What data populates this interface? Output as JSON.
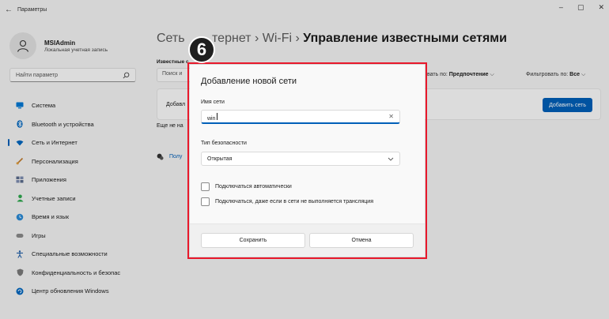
{
  "window": {
    "title": "Параметры",
    "back_glyph": "←",
    "minimize_glyph": "–",
    "maximize_glyph": "▢",
    "close_glyph": "✕"
  },
  "profile": {
    "name": "MSIAdmin",
    "account_type": "Локальная учетная запись"
  },
  "sidebar": {
    "search_placeholder": "Найти параметр",
    "items": [
      {
        "label": "Система",
        "icon": "monitor-icon",
        "color": "#0078d4"
      },
      {
        "label": "Bluetooth и устройства",
        "icon": "bluetooth-icon",
        "color": "#0067c0"
      },
      {
        "label": "Сеть и Интернет",
        "icon": "wifi-icon",
        "color": "#0067c0",
        "active": true
      },
      {
        "label": "Персонализация",
        "icon": "brush-icon",
        "color": "#c17a2c"
      },
      {
        "label": "Приложения",
        "icon": "apps-icon",
        "color": "#5b6b8c"
      },
      {
        "label": "Учетные записи",
        "icon": "person-icon",
        "color": "#2fa84f"
      },
      {
        "label": "Время и язык",
        "icon": "globe-clock-icon",
        "color": "#2c8bd6"
      },
      {
        "label": "Игры",
        "icon": "gamepad-icon",
        "color": "#8a8a8a"
      },
      {
        "label": "Специальные возможности",
        "icon": "accessibility-icon",
        "color": "#1f5fa8"
      },
      {
        "label": "Конфиденциальность и безопас",
        "icon": "shield-icon",
        "color": "#7a7a7a"
      },
      {
        "label": "Центр обновления Windows",
        "icon": "update-icon",
        "color": "#0067c0"
      }
    ]
  },
  "main": {
    "breadcrumb_part1": "Сеть ",
    "breadcrumb_part2": "тернет",
    "breadcrumb_sep1": " › ",
    "breadcrumb_part3": "Wi-Fi",
    "breadcrumb_sep2": " › ",
    "breadcrumb_current": "Управление известными сетями",
    "known_label": "Известные с",
    "search_placeholder": "Поиск и",
    "sort_prefix": "вать по: ",
    "sort_value": "Предпочтение",
    "filter_prefix": "Фильтровать по: ",
    "filter_value": "Все",
    "add_network_text": "Добавл",
    "add_network_button": "Добавить сеть",
    "more_text": "Еще не на",
    "get_help_text": "Полу"
  },
  "step": {
    "number": "6"
  },
  "dialog": {
    "title": "Добавление новой сети",
    "network_name_label": "Имя сети",
    "network_name_value": "win",
    "security_label": "Тип безопасности",
    "security_value": "Открытая",
    "auto_connect_label": "Подключаться автоматически",
    "auto_connect_checked": false,
    "hidden_connect_label": "Подключаться, даже если в сети не выполняется трансляция",
    "hidden_connect_checked": false,
    "save_button": "Сохранить",
    "cancel_button": "Отмена"
  },
  "colors": {
    "accent": "#005fb8",
    "highlight": "#e8182b",
    "background": "#f3f3f3"
  }
}
